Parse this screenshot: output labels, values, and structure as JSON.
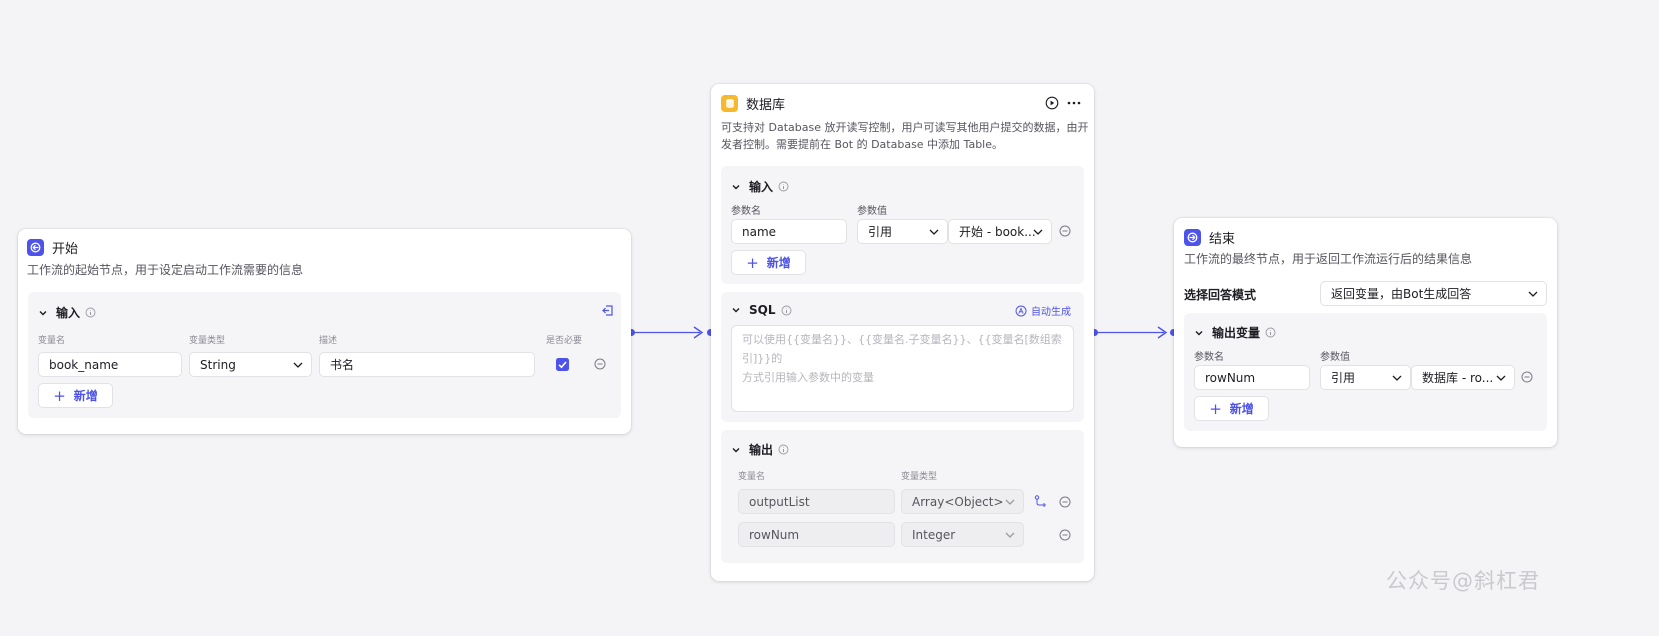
{
  "start_node": {
    "title": "开始",
    "description": "工作流的起始节点，用于设定启动工作流需要的信息",
    "input_section": {
      "title": "输入",
      "columns": [
        "变量名",
        "变量类型",
        "描述",
        "是否必要"
      ],
      "rows": [
        {
          "name": "book_name",
          "type": "String",
          "description": "书名",
          "required": true
        }
      ],
      "add_label": "新增"
    }
  },
  "database_node": {
    "title": "数据库",
    "description_line1": "可支持对 Database 放开读写控制，用户可读写其他用户提交的数据，由开",
    "description_line2": "发者控制。需要提前在 Bot 的 Database 中添加 Table。",
    "input_section": {
      "title": "输入",
      "columns": [
        "参数名",
        "参数值"
      ],
      "rows": [
        {
          "name": "name",
          "mode": "引用",
          "value": "开始 - book..."
        }
      ],
      "add_label": "新增"
    },
    "sql_section": {
      "title": "SQL",
      "auto_generate_label": "自动生成",
      "placeholder_line1": "可以使用{{变量名}}、{{变量名.子变量名}}、{{变量名[数组索引]}}的",
      "placeholder_line2": "方式引用输入参数中的变量"
    },
    "output_section": {
      "title": "输出",
      "columns": [
        "变量名",
        "变量类型"
      ],
      "rows": [
        {
          "name": "outputList",
          "type": "Array<Object>"
        },
        {
          "name": "rowNum",
          "type": "Integer"
        }
      ]
    }
  },
  "end_node": {
    "title": "结束",
    "description": "工作流的最终节点，用于返回工作流运行后的结果信息",
    "mode_label": "选择回答模式",
    "mode_value": "返回变量，由Bot生成回答",
    "output_section": {
      "title": "输出变量",
      "columns": [
        "参数名",
        "参数值"
      ],
      "rows": [
        {
          "name": "rowNum",
          "mode": "引用",
          "value": "数据库 - ro..."
        }
      ],
      "add_label": "新增"
    }
  },
  "watermark": "公众号@斜杠君",
  "colors": {
    "accent": "#4d53e8",
    "database_icon": "#f5b82e",
    "canvas": "#f4f4f6"
  }
}
